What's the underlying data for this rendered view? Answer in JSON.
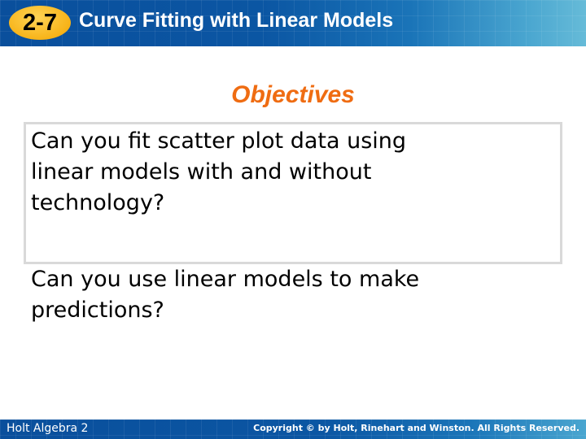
{
  "header": {
    "lesson_number": "2-7",
    "title": "Curve Fitting with Linear Models"
  },
  "main": {
    "heading": "Objectives",
    "objectives": [
      "Can you fit scatter plot data using\nlinear models with and without\ntechnology?",
      "Can you use linear models to make\npredictions?"
    ]
  },
  "footer": {
    "book": "Holt Algebra 2",
    "copyright": "Copyright © by Holt, Rinehart and Winston. All Rights Reserved."
  },
  "colors": {
    "header_blue": "#0b56a3",
    "badge_gold": "#f7b318",
    "heading_orange": "#ef6c12",
    "box_border": "#d9d9d9"
  }
}
